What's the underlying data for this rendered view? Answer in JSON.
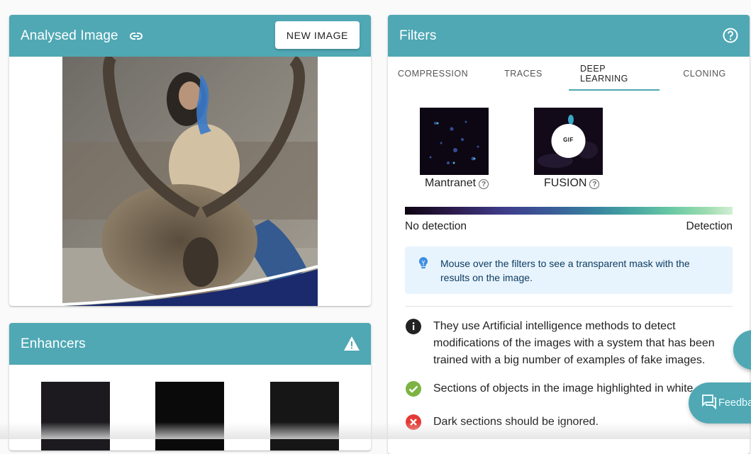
{
  "analysed_image": {
    "title": "Analysed Image",
    "link_icon": "link-icon",
    "new_image_label": "NEW IMAGE",
    "image_alt": "Man kneeling behind markhor goat with large spiral horns on rocky mountain slope, blue detection mask over face"
  },
  "enhancers": {
    "title": "Enhancers",
    "warning_icon": "warning-icon",
    "thumbnails": [
      "enhancer-thumb-1",
      "enhancer-thumb-2",
      "enhancer-thumb-3"
    ]
  },
  "filters": {
    "title": "Filters",
    "help_icon": "help-circle-icon",
    "tabs": [
      {
        "label": "COMPRESSION",
        "active": false
      },
      {
        "label": "TRACES",
        "active": false
      },
      {
        "label": "DEEP LEARNING",
        "active": true
      },
      {
        "label": "CLONING",
        "active": false
      }
    ],
    "results": [
      {
        "label": "Mantranet",
        "badge": null
      },
      {
        "label": "FUSION",
        "badge": "GIF"
      }
    ],
    "colorbar": {
      "left_label": "No detection",
      "right_label": "Detection"
    },
    "tip": "Mouse over the filters to see a transparent mask with the results on the image.",
    "legend": [
      {
        "icon": "info-icon",
        "text": "They use Artificial intelligence methods to detect modifications of the images with a system that has been trained with a big number of examples of fake images."
      },
      {
        "icon": "check-circle-icon",
        "text": "Sections of objects in the image highlighted in white."
      },
      {
        "icon": "cancel-circle-icon",
        "text": "Dark sections should be ignored."
      }
    ]
  },
  "feedback": {
    "label": "Feedback"
  },
  "colors": {
    "accent": "#4fa8b4",
    "info_bg": "#e8f4fd",
    "info_text": "#0d3c61",
    "success": "#7cb342",
    "error": "#e53935"
  }
}
